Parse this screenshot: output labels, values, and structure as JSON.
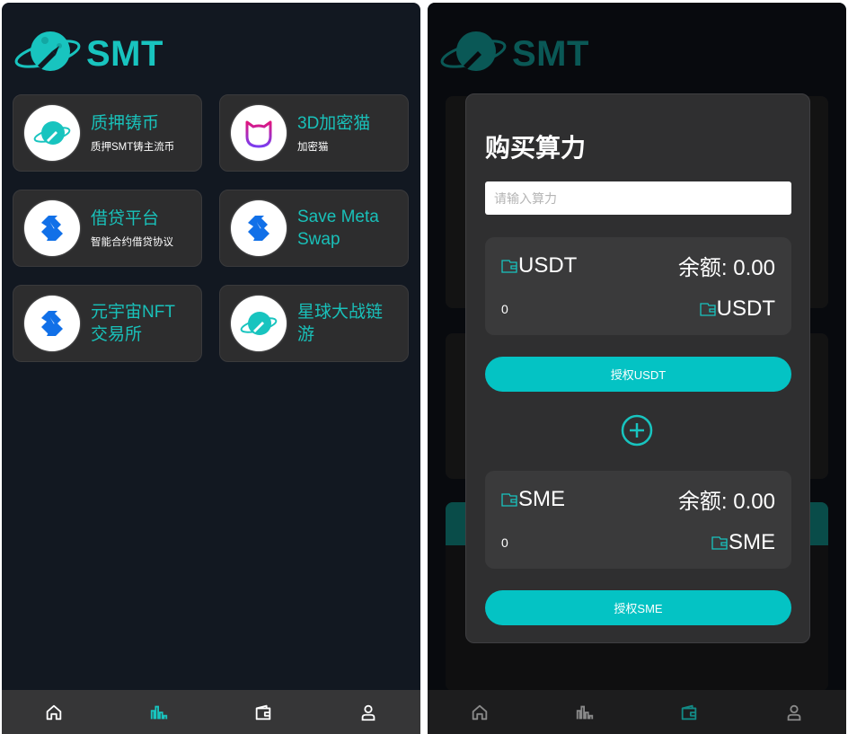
{
  "brand": {
    "name": "SMT",
    "accent": "#18c4bf"
  },
  "left": {
    "cards": [
      {
        "title": "质押铸币",
        "subtitle": "质押SMT铸主流币",
        "icon": "planet-rocket-icon"
      },
      {
        "title": "3D加密猫",
        "subtitle": "加密猫",
        "icon": "cat-outline-icon"
      },
      {
        "title": "借贷平台",
        "subtitle": "智能合约借贷协议",
        "icon": "swap-s-logo-icon"
      },
      {
        "title": "Save Meta Swap",
        "subtitle": "",
        "icon": "swap-s-logo-icon"
      },
      {
        "title": "元宇宙NFT交易所",
        "subtitle": "",
        "icon": "swap-s-logo-icon"
      },
      {
        "title": "星球大战链游",
        "subtitle": "",
        "icon": "planet-rocket-icon"
      }
    ],
    "tabbar": {
      "active": "market",
      "items": [
        "home",
        "market",
        "wallet",
        "profile"
      ]
    }
  },
  "right": {
    "modal": {
      "title": "购买算力",
      "input_placeholder": "请输入算力",
      "input_value": "",
      "usdt": {
        "token": "USDT",
        "balance_label": "余额:",
        "balance": "0.00",
        "amount": "0",
        "unit": "USDT"
      },
      "approve_usdt": "授权USDT",
      "sme": {
        "token": "SME",
        "balance_label": "余额:",
        "balance": "0.00",
        "amount": "0",
        "unit": "SME"
      },
      "approve_sme": "授权SME"
    },
    "tabbar": {
      "active": "wallet",
      "items": [
        "home",
        "market",
        "wallet",
        "profile"
      ]
    }
  },
  "colors": {
    "accent": "#18c4bf",
    "button": "#04c3c4",
    "card": "#2d2d2e",
    "background": "#121821",
    "tabbar": "#363637"
  }
}
